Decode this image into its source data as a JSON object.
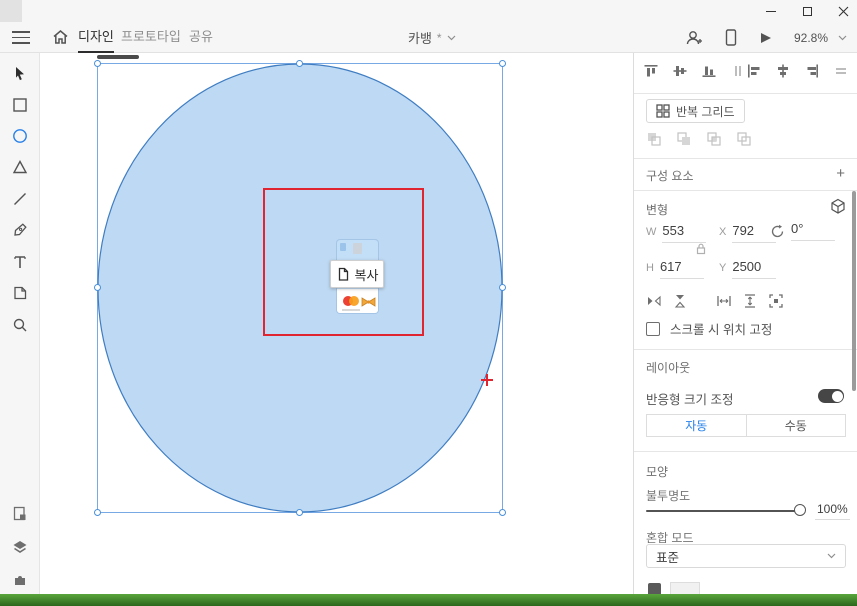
{
  "topbar": {
    "tabs": [
      {
        "label": "디자인",
        "active": true
      },
      {
        "label": "프로토타입",
        "active": false
      },
      {
        "label": "공유",
        "active": false
      }
    ],
    "document": {
      "name": "카뱅",
      "modified_marker": "*"
    },
    "zoom_level": "92.8%"
  },
  "tools_left": {
    "items": [
      "select",
      "rectangle",
      "ellipse",
      "polygon",
      "line",
      "pen",
      "text",
      "artboard",
      "zoom"
    ],
    "active_tool": "ellipse",
    "text_tool_glyph": "T",
    "bottom_items": [
      "assets",
      "layers",
      "plugins"
    ]
  },
  "canvas": {
    "drag_tooltip": {
      "label": "복사"
    },
    "colors": {
      "ellipse_fill": "#bed9f3",
      "ellipse_stroke": "#3f7dc2",
      "selection_blue": "#79a9e4",
      "red_rect": "#e02430",
      "cursor_red": "#e02430"
    }
  },
  "panel": {
    "repeat_grid": {
      "label": "반복 그리드"
    },
    "components": {
      "title": "구성 요소",
      "add_label": "+"
    },
    "transform": {
      "title": "변형",
      "w_label": "W",
      "w_value": "553",
      "x_label": "X",
      "x_value": "792",
      "rotation_value": "0°",
      "h_label": "H",
      "h_value": "617",
      "y_label": "Y",
      "y_value": "2500",
      "scroll_fix_label": "스크롤 시 위치 고정"
    },
    "layout": {
      "title": "레이아웃",
      "responsive_resize_label": "반응형 크기 조정",
      "toggle_on": true,
      "segment_auto": "자동",
      "segment_manual": "수동"
    },
    "appearance": {
      "title": "모양",
      "opacity_label": "불투명도",
      "opacity_value": "100%",
      "blend_mode_label": "혼합 모드",
      "blend_mode_value": "표준"
    }
  }
}
